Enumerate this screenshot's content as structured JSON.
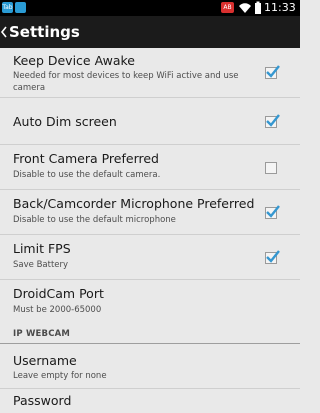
{
  "status_bar": {
    "notif1": "Tab",
    "notif2": "",
    "badge": "AB",
    "time": "11:33"
  },
  "action_bar": {
    "title": "Settings"
  },
  "prefs": {
    "keep_awake": {
      "title": "Keep Device Awake",
      "summary": "Needed for most devices to keep WiFi active and use camera",
      "checked": true
    },
    "auto_dim": {
      "title": "Auto Dim screen",
      "checked": true
    },
    "front_camera": {
      "title": "Front Camera Preferred",
      "summary": "Disable to use the default camera.",
      "checked": false
    },
    "back_mic": {
      "title": "Back/Camcorder Microphone Preferred",
      "summary": "Disable to use the default microphone",
      "checked": true
    },
    "limit_fps": {
      "title": "Limit FPS",
      "summary": "Save Battery",
      "checked": true
    },
    "port": {
      "title": "DroidCam Port",
      "summary": "Must be 2000-65000"
    },
    "section_ipwebcam": "IP WEBCAM",
    "username": {
      "title": "Username",
      "summary": "Leave empty for none"
    },
    "password": {
      "title": "Password"
    }
  },
  "colors": {
    "accent": "#3597d0",
    "background": "#e9e9e9",
    "action_bar": "#1b1b1b"
  }
}
